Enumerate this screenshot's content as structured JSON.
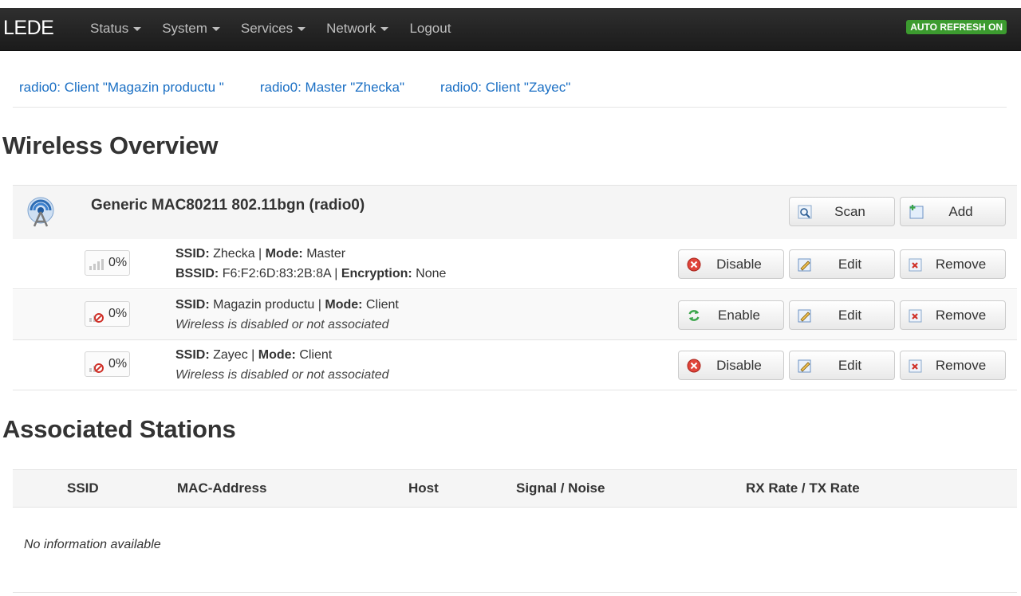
{
  "navbar": {
    "brand": "LEDE",
    "menu": [
      "Status",
      "System",
      "Services",
      "Network",
      "Logout"
    ],
    "auto_refresh": "AUTO REFRESH ON"
  },
  "tabs": [
    "radio0: Client \"Magazin productu \"",
    "radio0: Master \"Zhecka\"",
    "radio0: Client \"Zayec\""
  ],
  "wireless_overview": {
    "title": "Wireless Overview",
    "device": {
      "name": "Generic MAC80211 802.11bgn (radio0)",
      "scan_label": "Scan",
      "add_label": "Add"
    },
    "networks": [
      {
        "signal": "0%",
        "ssid_label": "SSID:",
        "ssid": "Zhecka",
        "mode_label": "Mode:",
        "mode": "Master",
        "line2_bssid_label": "BSSID:",
        "bssid": "F6:F2:6D:83:2B:8A",
        "encryption_label": "Encryption:",
        "encryption": "None",
        "toggle_label": "Disable",
        "edit_label": "Edit",
        "remove_label": "Remove"
      },
      {
        "signal": "0%",
        "ssid_label": "SSID:",
        "ssid": "Magazin productu",
        "mode_label": "Mode:",
        "mode": "Client",
        "status": "Wireless is disabled or not associated",
        "toggle_label": "Enable",
        "edit_label": "Edit",
        "remove_label": "Remove"
      },
      {
        "signal": "0%",
        "ssid_label": "SSID:",
        "ssid": "Zayec",
        "mode_label": "Mode:",
        "mode": "Client",
        "status": "Wireless is disabled or not associated",
        "toggle_label": "Disable",
        "edit_label": "Edit",
        "remove_label": "Remove"
      }
    ]
  },
  "associated_stations": {
    "title": "Associated Stations",
    "columns": [
      "SSID",
      "MAC-Address",
      "Host",
      "Signal / Noise",
      "RX Rate / TX Rate"
    ],
    "empty": "No information available"
  },
  "colors": {
    "navbar": "#222222",
    "link": "#1a6fc4",
    "auto_refresh_badge": "#3c9b2f"
  }
}
